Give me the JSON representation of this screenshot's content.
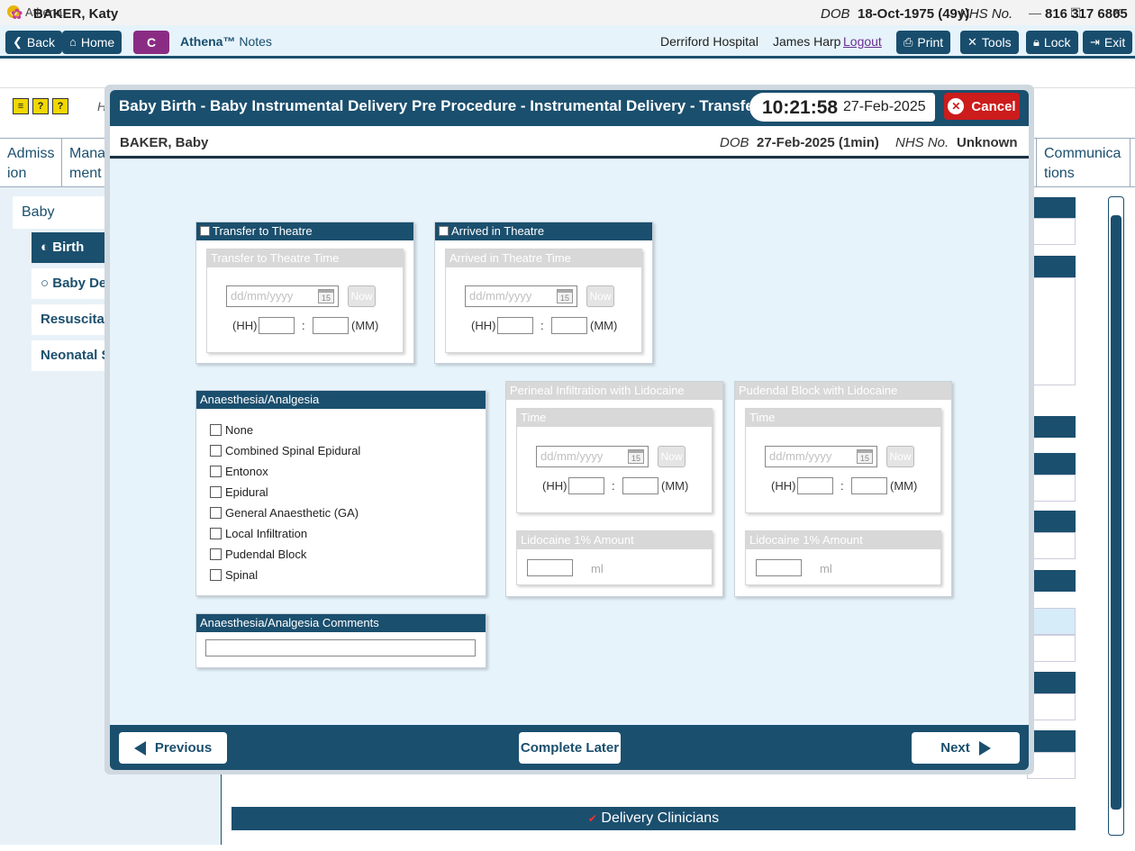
{
  "window": {
    "title": "Athena",
    "app_icon": "athena-logo-icon",
    "minimize": "—",
    "maximize": "☐",
    "close": "✕"
  },
  "toolbar": {
    "back_label": "Back",
    "home_label": "Home",
    "c_label": "C",
    "app_name": "Athena™",
    "app_suffix": "Notes",
    "hospital": "Derriford Hospital",
    "user": "James Harp",
    "logout": "Logout",
    "print_label": "Print",
    "tools_label": "Tools",
    "lock_label": "Lock",
    "exit_label": "Exit"
  },
  "patient": {
    "name": "BAKER, Katy",
    "dob_label": "DOB",
    "dob": "18-Oct-1975 (49y)",
    "nhs_label": "NHS No.",
    "nhs": "816 317 6805"
  },
  "background": {
    "icon_h": "H",
    "tabs": [
      {
        "label": "Admiss\nion"
      },
      {
        "label": "Mana\nment"
      },
      {
        "label": "Communica\ntions"
      }
    ],
    "baby_tab": "Baby",
    "side_items": [
      "Birth",
      "Baby Det",
      "Resuscitati",
      "Neonatal S"
    ],
    "delivery_clinicians": "Delivery Clinicians"
  },
  "modal": {
    "title": "Baby Birth - Baby Instrumental Delivery Pre Procedure - Instrumental Delivery - Transfer to Theatre",
    "time": "10:21:58",
    "date": "27-Feb-2025",
    "cancel_label": "Cancel",
    "baby": {
      "name": "BAKER, Baby",
      "dob_label": "DOB",
      "dob": "27-Feb-2025 (1min)",
      "nhs_label": "NHS No.",
      "nhs": "Unknown"
    },
    "transfer": {
      "header": "Transfer to Theatre",
      "sub_header": "Transfer to Theatre Time",
      "date_placeholder": "dd/mm/yyyy",
      "cal_day": "15",
      "now_label": "Now",
      "hh_label": "(HH)",
      "colon": ":",
      "mm_label": "(MM)"
    },
    "arrived": {
      "header": "Arrived in Theatre",
      "sub_header": "Arrived in Theatre Time",
      "date_placeholder": "dd/mm/yyyy",
      "cal_day": "15",
      "now_label": "Now",
      "hh_label": "(HH)",
      "colon": ":",
      "mm_label": "(MM)"
    },
    "anaesthesia": {
      "header": "Anaesthesia/Analgesia",
      "options": [
        "None",
        "Combined Spinal Epidural",
        "Entonox",
        "Epidural",
        "General Anaesthetic (GA)",
        "Local Infiltration",
        "Pudendal Block",
        "Spinal"
      ]
    },
    "comments": {
      "header": "Anaesthesia/Analgesia Comments"
    },
    "perineal": {
      "header": "Perineal Infiltration with Lidocaine",
      "time_header": "Time",
      "date_placeholder": "dd/mm/yyyy",
      "cal_day": "15",
      "now_label": "Now",
      "hh_label": "(HH)",
      "colon": ":",
      "mm_label": "(MM)",
      "amount_header": "Lidocaine 1% Amount",
      "unit": "ml"
    },
    "pudendal": {
      "header": "Pudendal Block with Lidocaine",
      "time_header": "Time",
      "date_placeholder": "dd/mm/yyyy",
      "cal_day": "15",
      "now_label": "Now",
      "hh_label": "(HH)",
      "colon": ":",
      "mm_label": "(MM)",
      "amount_header": "Lidocaine 1% Amount",
      "unit": "ml"
    },
    "footer": {
      "previous_label": "Previous",
      "complete_later_label": "Complete Later",
      "next_label": "Next"
    }
  },
  "colors": {
    "primary": "#1b4f6e",
    "accent_purple": "#8a2c83",
    "cancel_red": "#cc1c1c",
    "body_bg": "#e6f3fb"
  }
}
